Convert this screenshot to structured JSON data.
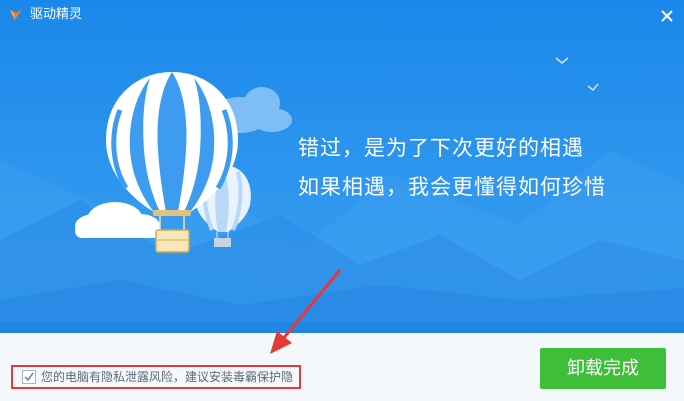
{
  "window": {
    "title": "驱动精灵",
    "close_icon": "close-icon",
    "logo_icon": "driver-genius-logo"
  },
  "banner": {
    "line1": "错过，是为了下次更好的相遇",
    "line2": "如果相遇，我会更懂得如何珍惜"
  },
  "footer": {
    "option_label": "您的电脑有隐私泄露风险，建议安装毒霸保护隐",
    "option_checked": true,
    "finish_button": "卸载完成"
  },
  "colors": {
    "sky": "#2e96ee",
    "finish_button": "#3fbe39",
    "annotation": "#e53935"
  }
}
